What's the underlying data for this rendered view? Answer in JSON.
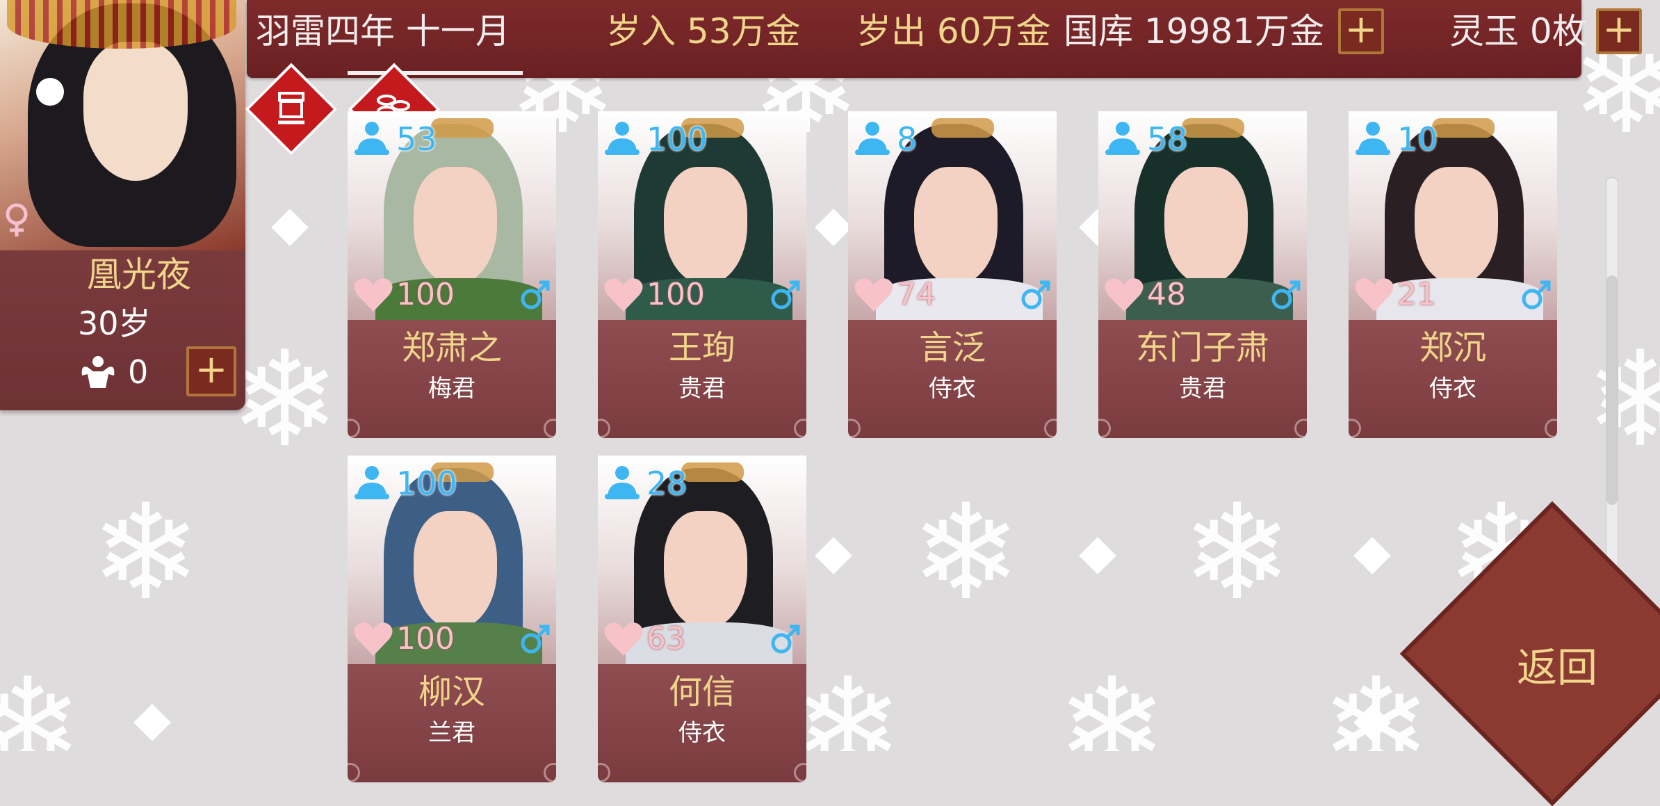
{
  "topbar": {
    "date": "羽雷四年 十一月",
    "income": "岁入 53万金",
    "expense": "岁出 60万金",
    "treasury": "国库 19981万金",
    "jade": "灵玉 0枚",
    "add_label": "+"
  },
  "player": {
    "name": "凰光夜",
    "age": "30岁",
    "stat": "0",
    "add_label": "+"
  },
  "consorts": [
    {
      "name": "郑肃之",
      "rank": "梅君",
      "energy": "53",
      "love": "100"
    },
    {
      "name": "王珣",
      "rank": "贵君",
      "energy": "100",
      "love": "100"
    },
    {
      "name": "言泛",
      "rank": "侍衣",
      "energy": "8",
      "love": "74"
    },
    {
      "name": "东门子肃",
      "rank": "贵君",
      "energy": "58",
      "love": "48"
    },
    {
      "name": "郑沉",
      "rank": "侍衣",
      "energy": "10",
      "love": "21"
    },
    {
      "name": "柳汉",
      "rank": "兰君",
      "energy": "100",
      "love": "100"
    },
    {
      "name": "何信",
      "rank": "侍衣",
      "energy": "28",
      "love": "63"
    }
  ],
  "back_label": "返回",
  "colors": {
    "accent": "#7e2a2b",
    "gold": "#f0d58a",
    "energy": "#3eb6f2",
    "love": "#f7c2c8"
  }
}
